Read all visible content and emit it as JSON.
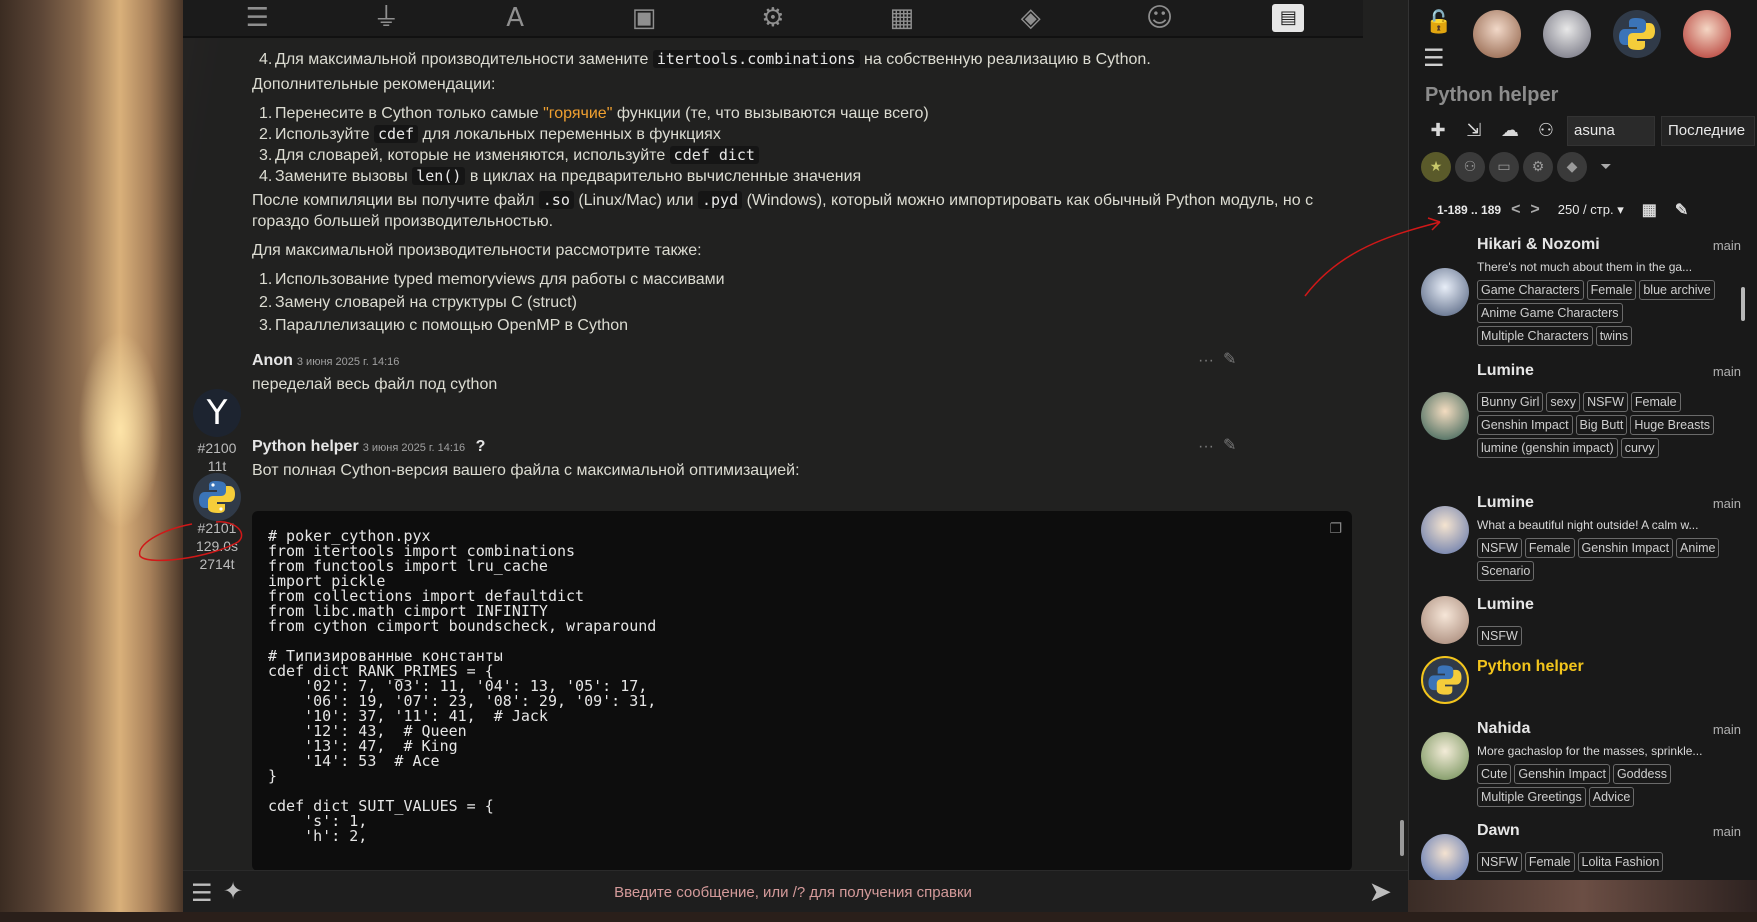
{
  "chat": {
    "list1_item4": [
      "Для максимальной производительности замените ",
      "itertools.combinations",
      " на собственную реализацию в Cython."
    ],
    "additional_heading": "Дополнительные рекомендации:",
    "recs": {
      "r1": [
        "Перенесите в Cython только самые ",
        "\"горячие\"",
        " функции (те, что вызываются чаще всего)"
      ],
      "r2": [
        "Используйте ",
        "cdef",
        " для локальных переменных в функциях"
      ],
      "r3": [
        "Для словарей, которые не изменяются, используйте ",
        "cdef dict"
      ],
      "r4": [
        "Замените вызовы ",
        "len()",
        " в циклах на предварительно вычисленные значения"
      ]
    },
    "after_compile": [
      "После компиляции вы получите файл ",
      ".so",
      " (Linux/Mac) или ",
      ".pyd",
      " (Windows), который можно импортировать как обычный Python модуль, но с"
    ],
    "after_compile_2": "гораздо большей производительностью.",
    "consider_heading": "Для максимальной производительности рассмотрите также:",
    "consider": [
      "Использование typed memoryviews для работы с массивами",
      "Замену словарей на структуры C (struct)",
      "Параллелизацию с помощью OpenMP в Cython"
    ],
    "nums": [
      "1.",
      "2.",
      "3.",
      "4."
    ],
    "msg_user": {
      "name": "Anon",
      "time": "3 июня 2025 г. 14:16",
      "id": "#2100",
      "tokens": "11t",
      "avatar_letter": "Y",
      "text": "переделай весь файл под cython"
    },
    "msg_bot": {
      "name": "Python helper",
      "time": "3 июня 2025 г. 14:16",
      "id": "#2101",
      "duration": "129.0s",
      "tokens": "2714t",
      "help_mark": "?",
      "text": "Вот полная Cython-версия вашего файла с максимальной оптимизацией:",
      "code": "# poker_cython.pyx\nfrom itertools import combinations\nfrom functools import lru_cache\nimport pickle\nfrom collections import defaultdict\nfrom libc.math cimport INFINITY\nfrom cython cimport boundscheck, wraparound\n\n# Типизированные константы\ncdef dict RANK_PRIMES = {\n    '02': 7, '03': 11, '04': 13, '05': 17,\n    '06': 19, '07': 23, '08': 29, '09': 31,\n    '10': 37, '11': 41,  # Jack\n    '12': 43,  # Queen\n    '13': 47,  # King\n    '14': 53  # Ace\n}\n\ncdef dict SUIT_VALUES = {\n    's': 1,\n    'h': 2,"
    },
    "input_placeholder": "Введите сообщение, или /? для получения справки"
  },
  "panel": {
    "title": "Python helper",
    "tag_search": "asuna",
    "sort": "Последние",
    "pager": {
      "range": "1-189 .. 189",
      "prev": "<",
      "next": ">",
      "per_page": "250 / стр."
    },
    "characters": [
      {
        "name": "Hikari & Nozomi",
        "main": "main",
        "desc": "There's not much about them in the ga...",
        "tags": [
          "Game Characters",
          "Female",
          "blue archive",
          "Anime Game Characters",
          "Multiple Characters",
          "twins"
        ]
      },
      {
        "name": "Lumine",
        "main": "main",
        "desc": "",
        "tags": [
          "Bunny Girl",
          "sexy",
          "NSFW",
          "Female",
          "Genshin Impact",
          "Big Butt",
          "Huge Breasts",
          "lumine (genshin impact)",
          "curvy"
        ]
      },
      {
        "name": "Lumine",
        "main": "main",
        "desc": "What a beautiful night outside! A calm w...",
        "tags": [
          "NSFW",
          "Female",
          "Genshin Impact",
          "Anime",
          "Scenario"
        ]
      },
      {
        "name": "Lumine",
        "main": "",
        "desc": "",
        "tags": [
          "NSFW"
        ]
      },
      {
        "name": "Python helper",
        "main": "",
        "desc": "",
        "tags": []
      },
      {
        "name": "Nahida",
        "main": "main",
        "desc": "More gachaslop for the masses, sprinkle...",
        "tags": [
          "Cute",
          "Genshin Impact",
          "Goddess",
          "Multiple Greetings",
          "Advice"
        ]
      },
      {
        "name": "Dawn",
        "main": "main",
        "desc": "",
        "tags": [
          "NSFW",
          "Female",
          "Lolita Fashion"
        ]
      }
    ]
  },
  "colors": {
    "accent_selected": "#f3c51c",
    "highlight": "#f0a030",
    "placeholder": "#d49a9a",
    "annotation": "#d01818"
  }
}
